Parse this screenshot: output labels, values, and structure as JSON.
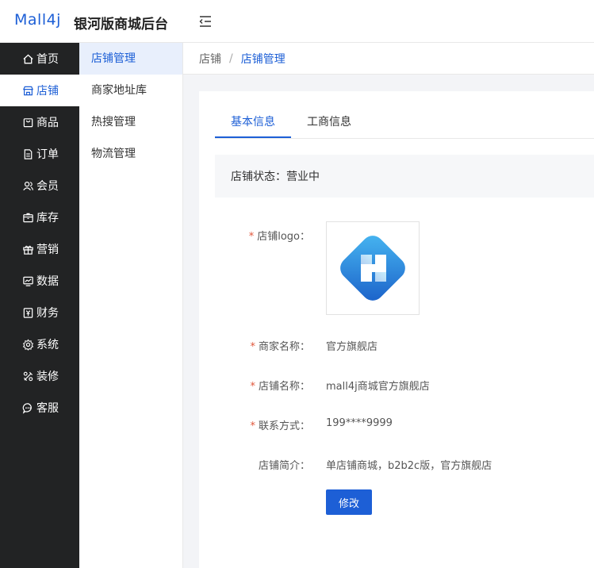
{
  "header": {
    "logo": "Mall4j",
    "title": "银河版商城后台"
  },
  "sidebar": {
    "items": [
      {
        "label": "首页",
        "icon": "home-icon"
      },
      {
        "label": "店铺",
        "icon": "shop-icon"
      },
      {
        "label": "商品",
        "icon": "goods-icon"
      },
      {
        "label": "订单",
        "icon": "order-icon"
      },
      {
        "label": "会员",
        "icon": "member-icon"
      },
      {
        "label": "库存",
        "icon": "inventory-icon"
      },
      {
        "label": "营销",
        "icon": "gift-icon"
      },
      {
        "label": "数据",
        "icon": "chart-icon"
      },
      {
        "label": "财务",
        "icon": "finance-icon"
      },
      {
        "label": "系统",
        "icon": "gear-icon"
      },
      {
        "label": "装修",
        "icon": "decorate-icon"
      },
      {
        "label": "客服",
        "icon": "chat-icon"
      }
    ],
    "active": "店铺"
  },
  "submenu": {
    "items": [
      {
        "label": "店铺管理"
      },
      {
        "label": "商家地址库"
      },
      {
        "label": "热搜管理"
      },
      {
        "label": "物流管理"
      }
    ],
    "active": "店铺管理"
  },
  "breadcrumb": {
    "home": "店铺",
    "separator": "/",
    "current": "店铺管理"
  },
  "tabs": [
    {
      "label": "基本信息"
    },
    {
      "label": "工商信息"
    }
  ],
  "status": {
    "text": "店铺状态：营业中"
  },
  "form": {
    "logo_label": "店铺logo：",
    "merchant_name_label": "商家名称：",
    "merchant_name": "官方旗舰店",
    "shop_name_label": "店铺名称：",
    "shop_name": "mall4j商城官方旗舰店",
    "contact_label": "联系方式：",
    "contact": "199****9999",
    "intro_label": "店铺简介：",
    "intro": "单店铺商城，b2b2c版，官方旗舰店",
    "required_mark": "*",
    "edit_button": "修改"
  },
  "colors": {
    "primary": "#1d5fd6",
    "sidebar_bg": "#222324",
    "required": "#e0563b"
  }
}
